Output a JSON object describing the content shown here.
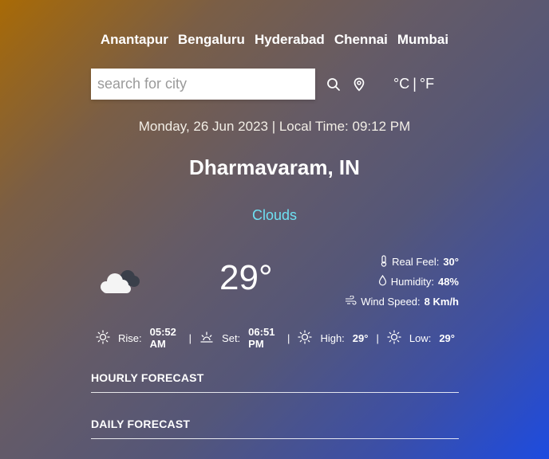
{
  "cities": [
    "Anantapur",
    "Bengaluru",
    "Hyderabad",
    "Chennai",
    "Mumbai"
  ],
  "search": {
    "placeholder": "search for city",
    "value": ""
  },
  "units": {
    "celsius": "°C",
    "separator": "|",
    "fahrenheit": "°F"
  },
  "datetime": "Monday, 26 Jun 2023 | Local Time: 09:12 PM",
  "location": "Dharmavaram, IN",
  "condition": "Clouds",
  "temperature": "29°",
  "details": {
    "real_feel_label": "Real Feel:",
    "real_feel": "30°",
    "humidity_label": "Humidity:",
    "humidity": "48%",
    "wind_label": "Wind Speed:",
    "wind": "8 Km/h"
  },
  "sun": {
    "rise_label": "Rise:",
    "rise": "05:52 AM",
    "set_label": "Set:",
    "set": "06:51 PM",
    "high_label": "High:",
    "high": "29°",
    "low_label": "Low:",
    "low": "29°"
  },
  "sections": {
    "hourly": "HOURLY FORECAST",
    "daily": "DAILY FORECAST"
  },
  "colors": {
    "condition": "#6ee0f2",
    "gradient_start": "#a86a06",
    "gradient_end": "#1d4be0"
  },
  "icons": [
    "search-icon",
    "location-pin-icon",
    "cloud-icon",
    "thermometer-icon",
    "droplet-icon",
    "wind-icon",
    "sun-icon"
  ]
}
